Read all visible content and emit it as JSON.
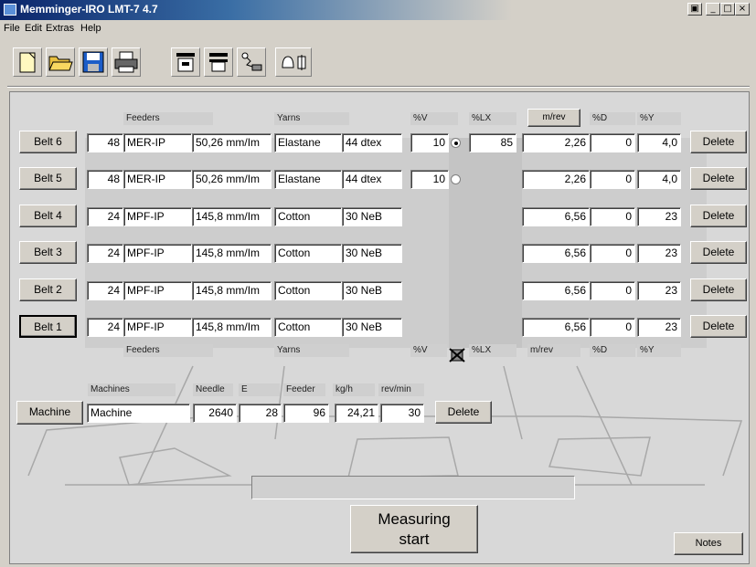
{
  "window": {
    "title": "Memminger-IRO LMT-7 4.7",
    "controls": [
      "▣",
      "_",
      "□",
      "×"
    ]
  },
  "menu": [
    "File",
    "Edit",
    "Extras",
    "Help"
  ],
  "toolbar_icons": [
    "new-file-icon",
    "open-folder-icon",
    "save-disk-icon",
    "print-icon",
    "machine-settings-icon",
    "machine-print-icon",
    "wiring-icon",
    "bell-sensor-icon"
  ],
  "headers": {
    "feeders": "Feeders",
    "yarns": "Yarns",
    "pct_v": "%V",
    "pct_lx": "%LX",
    "m_rev": "m/rev",
    "pct_d": "%D",
    "pct_y": "%Y"
  },
  "belts": [
    {
      "label": "Belt 6",
      "count": "48",
      "feeder": "MER-IP",
      "speed": "50,26 mm/Im",
      "yarn": "Elastane",
      "dtex": "44 dtex",
      "pct_v": "10",
      "radio": true,
      "pct_lx": "85",
      "m_rev": "2,26",
      "pct_d": "0",
      "pct_y": "4,0",
      "delete": "Delete"
    },
    {
      "label": "Belt 5",
      "count": "48",
      "feeder": "MER-IP",
      "speed": "50,26 mm/Im",
      "yarn": "Elastane",
      "dtex": "44 dtex",
      "pct_v": "10",
      "radio": false,
      "pct_lx": "",
      "m_rev": "2,26",
      "pct_d": "0",
      "pct_y": "4,0",
      "delete": "Delete"
    },
    {
      "label": "Belt 4",
      "count": "24",
      "feeder": "MPF-IP",
      "speed": "145,8 mm/Im",
      "yarn": "Cotton",
      "dtex": "30 NeB",
      "pct_v": "",
      "pct_lx": "",
      "m_rev": "6,56",
      "pct_d": "0",
      "pct_y": "23",
      "delete": "Delete"
    },
    {
      "label": "Belt 3",
      "count": "24",
      "feeder": "MPF-IP",
      "speed": "145,8 mm/Im",
      "yarn": "Cotton",
      "dtex": "30 NeB",
      "pct_v": "",
      "pct_lx": "",
      "m_rev": "6,56",
      "pct_d": "0",
      "pct_y": "23",
      "delete": "Delete"
    },
    {
      "label": "Belt 2",
      "count": "24",
      "feeder": "MPF-IP",
      "speed": "145,8 mm/Im",
      "yarn": "Cotton",
      "dtex": "30 NeB",
      "pct_v": "",
      "pct_lx": "",
      "m_rev": "6,56",
      "pct_d": "0",
      "pct_y": "23",
      "delete": "Delete"
    },
    {
      "label": "Belt 1",
      "count": "24",
      "feeder": "MPF-IP",
      "speed": "145,8 mm/Im",
      "yarn": "Cotton",
      "dtex": "30 NeB",
      "pct_v": "",
      "pct_lx": "",
      "m_rev": "6,56",
      "pct_d": "0",
      "pct_y": "23",
      "delete": "Delete"
    }
  ],
  "machine": {
    "headers": {
      "machines": "Machines",
      "needle": "Needle",
      "e": "E",
      "feeder": "Feeder",
      "kgh": "kg/h",
      "revmin": "rev/min"
    },
    "button": "Machine",
    "name": "Machine",
    "needle": "2640",
    "e": "28",
    "feeder": "96",
    "kgh": "24,21",
    "revmin": "30",
    "delete": "Delete"
  },
  "measuring": {
    "line1": "Measuring",
    "line2": "start"
  },
  "notes": "Notes"
}
